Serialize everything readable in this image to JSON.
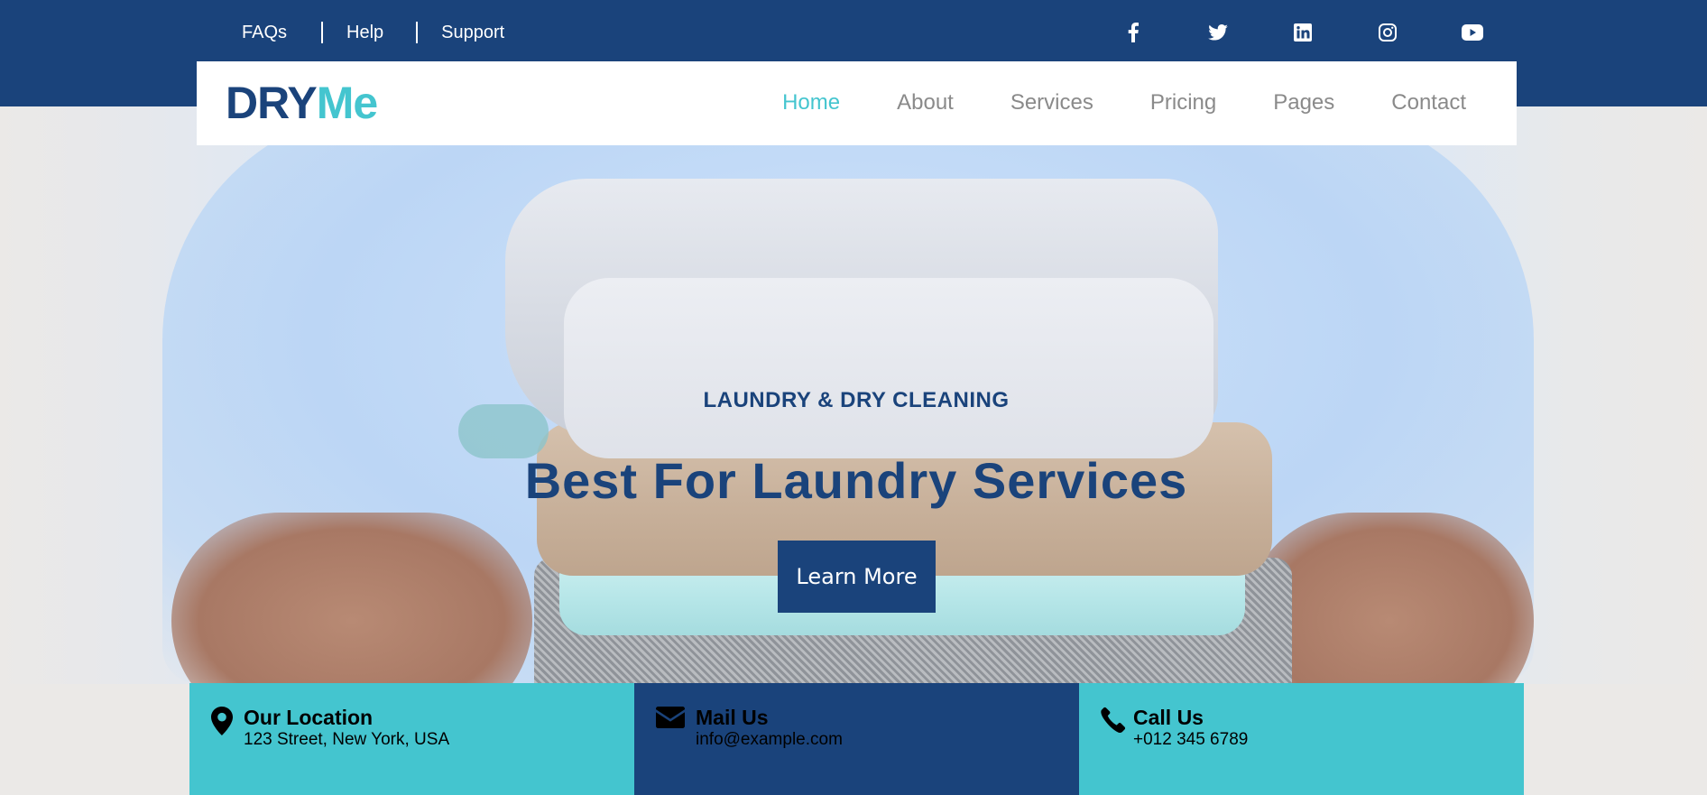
{
  "topbar": {
    "links": [
      "FAQs",
      "Help",
      "Support"
    ],
    "socials": [
      "facebook-icon",
      "twitter-icon",
      "linkedin-icon",
      "instagram-icon",
      "youtube-icon"
    ]
  },
  "brand": {
    "part1": "DRY",
    "part2": "Me"
  },
  "nav": {
    "items": [
      "Home",
      "About",
      "Services",
      "Pricing",
      "Pages",
      "Contact"
    ],
    "active": "Home"
  },
  "hero": {
    "subtitle": "LAUNDRY & DRY CLEANING",
    "title": "Best For Laundry Services",
    "button": "Learn More"
  },
  "info": [
    {
      "icon": "location-pin-icon",
      "title": "Our Location",
      "text": "123 Street, New York, USA"
    },
    {
      "icon": "envelope-icon",
      "title": "Mail Us",
      "text": "info@example.com"
    },
    {
      "icon": "phone-icon",
      "title": "Call Us",
      "text": "+012 345 6789"
    }
  ],
  "colors": {
    "primary": "#1a437b",
    "accent": "#44c5cf",
    "nav_text": "#8a8a8a"
  }
}
